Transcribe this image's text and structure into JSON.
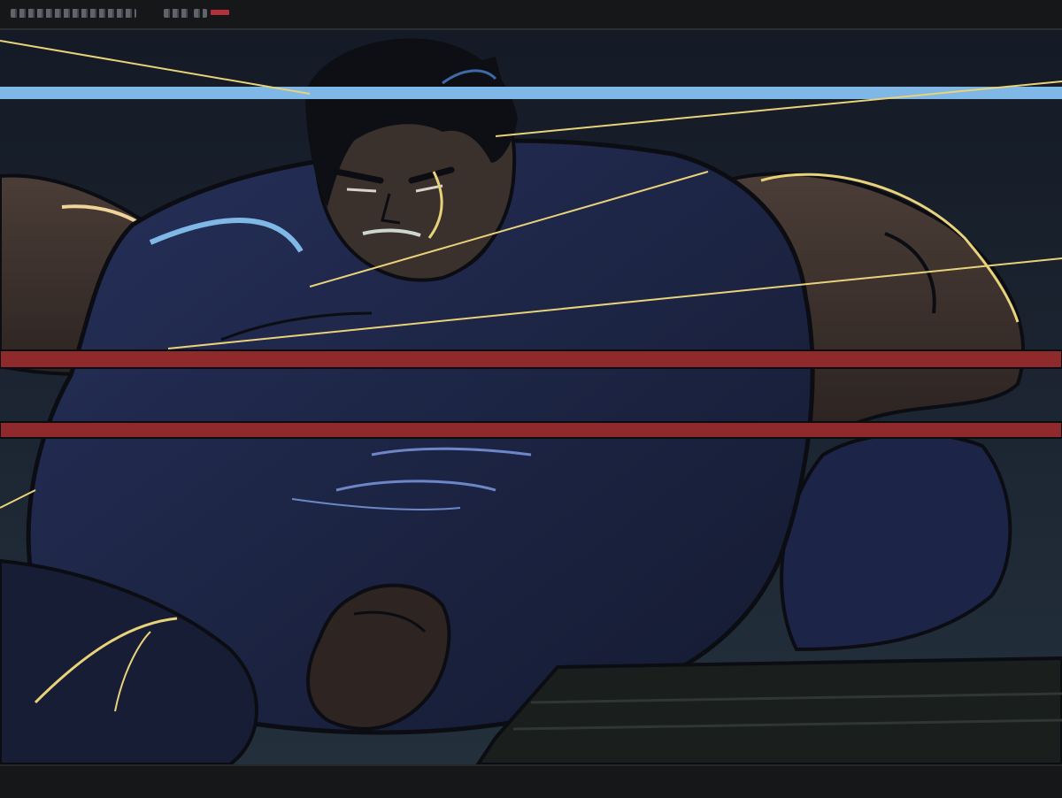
{
  "scene": {
    "subject": "wrestler-illustration",
    "colors": {
      "background": "#141a26",
      "shirt": "#1c2440",
      "skin": "#3a302c",
      "rope_red": "#8e2a2c",
      "rope_blue": "#7fb8e6",
      "highlight_yellow": "#e8d27a"
    }
  }
}
